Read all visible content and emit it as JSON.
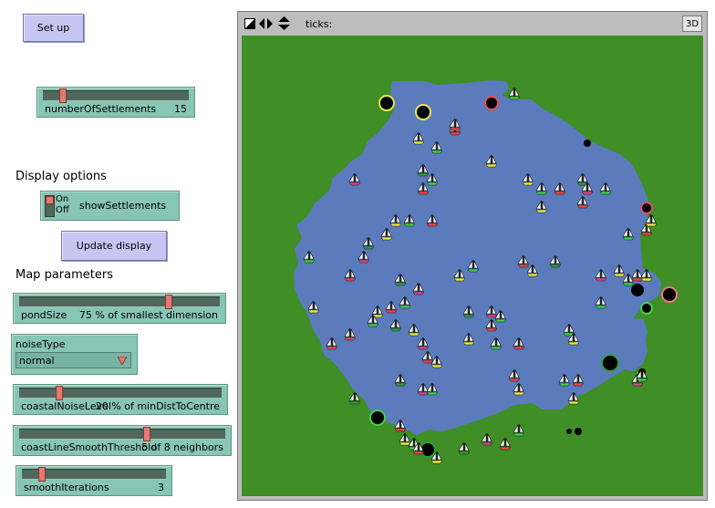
{
  "buttons": {
    "setup": "Set up",
    "update_display": "Update display"
  },
  "sliders": {
    "number_of_settlements": {
      "label": "numberOfSettlements",
      "value": "15",
      "fraction": 0.11
    },
    "pond_size": {
      "label": "pondSize",
      "value": "75 % of smallest dimension",
      "fraction": 0.75
    },
    "coastal_noise_level": {
      "label": "coastalNoiseLevel",
      "value": "20 % of minDistToCentre",
      "fraction": 0.2
    },
    "coast_line_smooth_threshold": {
      "label": "coastLineSmoothThreshold",
      "value": "5 of 8 neighbors",
      "fraction": 0.62
    },
    "smooth_iterations": {
      "label": "smoothIterations",
      "value": "3",
      "fraction": 0.15
    }
  },
  "sections": {
    "display_options": "Display options",
    "map_parameters": "Map parameters"
  },
  "switch": {
    "on": "On",
    "off": "Off",
    "label": "showSettlements",
    "state": "on"
  },
  "chooser": {
    "label": "noiseType",
    "value": "normal"
  },
  "view": {
    "ticks_label": "ticks:",
    "mode_3d": "3D"
  },
  "colors": {
    "land": "#3f8e26",
    "water": "#5b7bbd",
    "button": "#c6c6f3",
    "widget": "#87c5b4",
    "thumb": "#e07b75",
    "view_frame": "#bdbdbd"
  },
  "icons": [
    "settings-sail-icon",
    "arrows-horizontal-icon",
    "arrows-vertical-icon",
    "sailboat-icon",
    "settlement-icon"
  ]
}
